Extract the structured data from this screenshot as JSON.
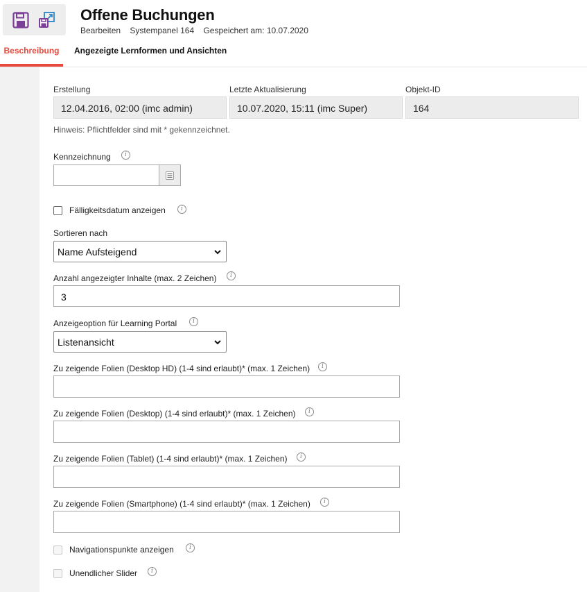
{
  "header": {
    "title": "Offene Buchungen",
    "mode": "Bearbeiten",
    "object": "Systempanel 164",
    "saved": "Gespeichert am: 10.07.2020"
  },
  "toolbar": {
    "save_icon": "floppy-disk-icon",
    "export_icon": "export-icon"
  },
  "tabs": [
    {
      "label": "Beschreibung",
      "active": true
    },
    {
      "label": "Angezeigte Lernformen und Ansichten",
      "active": false
    }
  ],
  "info": {
    "creation": {
      "label": "Erstellung",
      "value": "12.04.2016, 02:00 (imc admin)"
    },
    "update": {
      "label": "Letzte Aktualisierung",
      "value": "10.07.2020, 15:11 (imc Super)"
    },
    "object_id": {
      "label": "Objekt-ID",
      "value": "164"
    }
  },
  "hint": "Hinweis: Pflichtfelder sind mit * gekennzeichnet.",
  "form": {
    "kennzeichnung": {
      "label": "Kennzeichnung",
      "value": ""
    },
    "faelligkeit": {
      "label": "Fälligkeitsdatum anzeigen",
      "checked": false
    },
    "sort": {
      "label": "Sortieren nach",
      "value": "Name Aufsteigend"
    },
    "anzahl": {
      "label": "Anzahl angezeigter Inhalte (max. 2 Zeichen)",
      "value": "3"
    },
    "anzeigeoption": {
      "label": "Anzeigeoption für Learning Portal",
      "value": "Listenansicht"
    },
    "folien_hd": {
      "label": "Zu zeigende Folien (Desktop HD) (1-4 sind erlaubt)* (max. 1 Zeichen)",
      "value": ""
    },
    "folien_desktop": {
      "label": "Zu zeigende Folien (Desktop) (1-4 sind erlaubt)* (max. 1 Zeichen)",
      "value": ""
    },
    "folien_tablet": {
      "label": "Zu zeigende Folien (Tablet) (1-4 sind erlaubt)* (max. 1 Zeichen)",
      "value": ""
    },
    "folien_smartphone": {
      "label": "Zu zeigende Folien (Smartphone) (1-4 sind erlaubt)* (max. 1 Zeichen)",
      "value": ""
    },
    "navigationspunkte": {
      "label": "Navigationspunkte anzeigen",
      "checked": false,
      "disabled": true
    },
    "slider": {
      "label": "Unendlicher Slider",
      "checked": false,
      "disabled": true
    }
  },
  "colors": {
    "accent": "#e8483b",
    "icon_purple": "#7b3f98",
    "icon_blue": "#2a86c9"
  }
}
